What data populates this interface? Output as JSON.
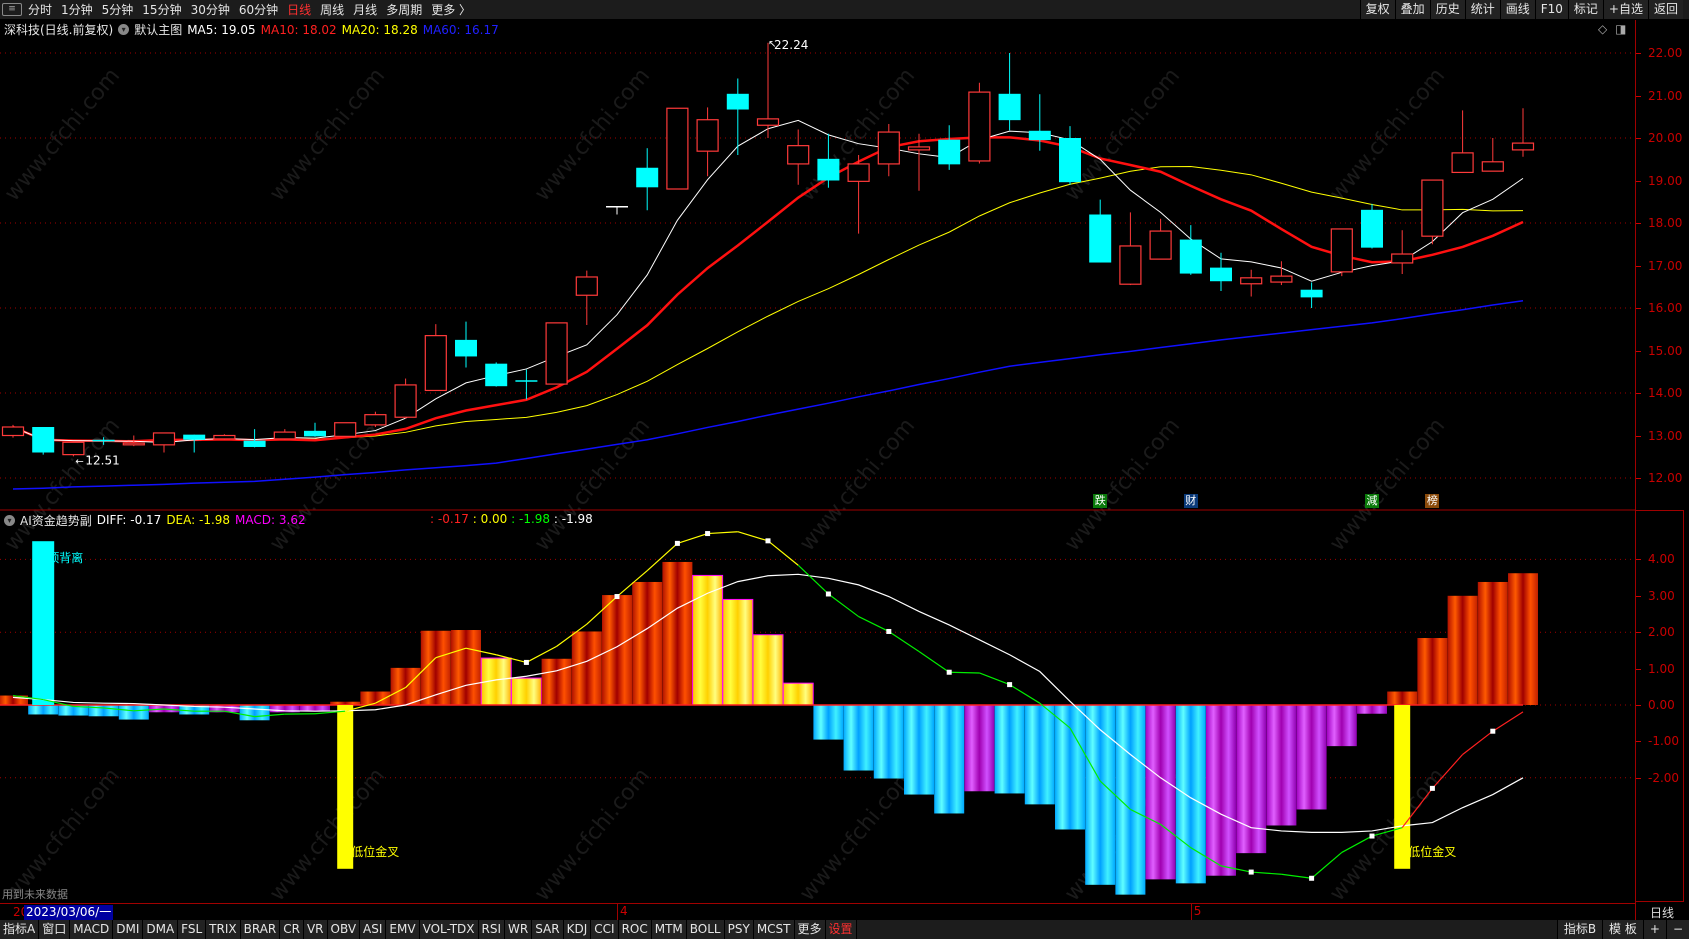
{
  "toolbar": {
    "periods": [
      "分时",
      "1分钟",
      "5分钟",
      "15分钟",
      "30分钟",
      "60分钟",
      "日线",
      "周线",
      "月线",
      "多周期",
      "更多 〉"
    ],
    "active_period": "日线",
    "right_buttons": [
      "复权",
      "叠加",
      "历史",
      "统计",
      "画线",
      "F10",
      "标记",
      "+自选",
      "返回"
    ]
  },
  "main_info": {
    "title": "深科技(日线.前复权)",
    "template": "默认主图",
    "ma5": "MA5: 19.05",
    "ma10": "MA10: 18.02",
    "ma20": "MA20: 18.28",
    "ma60": "MA60: 16.17"
  },
  "colors": {
    "up": "#ff3a3a",
    "down": "#00ffff",
    "ma5": "#ffffff",
    "ma10": "#ff1010",
    "ma20": "#ffff00",
    "ma60": "#1010ff",
    "axis": "#c80000"
  },
  "price_axis": {
    "labels": [
      "22.00",
      "21.00",
      "20.00",
      "19.00",
      "18.00",
      "17.00",
      "16.00",
      "15.00",
      "14.00",
      "13.00",
      "12.00"
    ]
  },
  "annotations": {
    "high_label": "22.24",
    "high_index": 25,
    "low_label": "12.51",
    "low_index": 2
  },
  "signal_tags": [
    {
      "text": "跌",
      "index": 36,
      "color": "#0a7a0a"
    },
    {
      "text": "财",
      "index": 39,
      "color": "#0a3a7a"
    },
    {
      "text": "減",
      "index": 45,
      "color": "#0a7a0a"
    },
    {
      "text": "榜",
      "index": 47,
      "color": "#8a4a0a"
    }
  ],
  "chart_data": {
    "type": "candlestick",
    "ylim": [
      11.5,
      22.5
    ],
    "ohlc": [
      [
        13.0,
        13.25,
        12.95,
        13.2
      ],
      [
        13.2,
        13.2,
        12.55,
        12.6
      ],
      [
        12.55,
        12.85,
        12.51,
        12.84
      ],
      [
        12.9,
        12.96,
        12.78,
        12.86
      ],
      [
        12.78,
        13.0,
        12.75,
        12.82
      ],
      [
        12.78,
        13.07,
        12.6,
        13.06
      ],
      [
        13.02,
        13.02,
        12.6,
        12.9
      ],
      [
        12.92,
        13.03,
        12.9,
        13.0
      ],
      [
        12.88,
        13.15,
        12.72,
        12.73
      ],
      [
        12.92,
        13.15,
        12.9,
        13.08
      ],
      [
        13.11,
        13.3,
        12.97,
        12.98
      ],
      [
        12.98,
        13.3,
        12.97,
        13.3
      ],
      [
        13.25,
        13.56,
        13.2,
        13.49
      ],
      [
        13.43,
        14.34,
        13.4,
        14.19
      ],
      [
        14.06,
        15.62,
        14.05,
        15.35
      ],
      [
        15.25,
        15.68,
        14.6,
        14.86
      ],
      [
        14.69,
        14.72,
        14.15,
        14.16
      ],
      [
        14.3,
        14.55,
        13.85,
        14.27
      ],
      [
        14.21,
        15.65,
        14.2,
        15.65
      ],
      [
        16.3,
        16.88,
        15.6,
        16.73
      ],
      [
        18.4,
        18.4,
        18.2,
        18.4
      ],
      [
        19.3,
        19.76,
        18.3,
        18.84
      ],
      [
        18.8,
        20.7,
        18.8,
        20.7
      ],
      [
        19.69,
        20.72,
        19.1,
        20.43
      ],
      [
        21.04,
        21.4,
        19.6,
        20.67
      ],
      [
        20.3,
        22.24,
        20.0,
        20.45
      ],
      [
        19.39,
        20.2,
        18.9,
        19.82
      ],
      [
        19.51,
        20.1,
        18.83,
        19.0
      ],
      [
        18.98,
        19.6,
        17.75,
        19.39
      ],
      [
        19.39,
        20.33,
        19.1,
        20.14
      ],
      [
        19.72,
        20.1,
        18.76,
        19.79
      ],
      [
        19.96,
        20.3,
        19.25,
        19.38
      ],
      [
        19.46,
        21.3,
        19.4,
        21.08
      ],
      [
        21.04,
        22.0,
        20.18,
        20.42
      ],
      [
        20.17,
        21.03,
        19.7,
        19.95
      ],
      [
        20.0,
        20.28,
        18.9,
        18.96
      ],
      [
        18.2,
        18.55,
        17.07,
        17.07
      ],
      [
        16.56,
        18.25,
        16.54,
        17.46
      ],
      [
        17.15,
        18.1,
        17.15,
        17.81
      ],
      [
        17.61,
        17.95,
        16.78,
        16.81
      ],
      [
        16.95,
        17.3,
        16.4,
        16.63
      ],
      [
        16.57,
        16.9,
        16.27,
        16.71
      ],
      [
        16.61,
        17.1,
        16.54,
        16.75
      ],
      [
        16.43,
        16.6,
        16.0,
        16.25
      ],
      [
        16.85,
        17.86,
        16.75,
        17.86
      ],
      [
        18.31,
        18.45,
        17.4,
        17.42
      ],
      [
        17.06,
        17.83,
        16.8,
        17.27
      ],
      [
        17.69,
        19.01,
        17.5,
        19.01
      ],
      [
        19.19,
        20.65,
        19.18,
        19.65
      ],
      [
        19.22,
        20.0,
        19.22,
        19.44
      ],
      [
        19.72,
        20.7,
        19.56,
        19.88
      ]
    ],
    "ma60": [
      11.74,
      11.76,
      11.79,
      11.81,
      11.83,
      11.85,
      11.88,
      11.9,
      11.92,
      11.97,
      12.02,
      12.08,
      12.13,
      12.19,
      12.24,
      12.29,
      12.35,
      12.46,
      12.57,
      12.68,
      12.79,
      12.9,
      13.04,
      13.19,
      13.33,
      13.48,
      13.62,
      13.76,
      13.91,
      14.05,
      14.2,
      14.34,
      14.49,
      14.63,
      14.72,
      14.81,
      14.9,
      14.98,
      15.07,
      15.16,
      15.25,
      15.33,
      15.41,
      15.49,
      15.57,
      15.65,
      15.75,
      15.86,
      15.96,
      16.07,
      16.17
    ]
  },
  "indicator": {
    "name": "AI资金趋势副",
    "diff_label": "DIFF: -0.17",
    "dea_label": "DEA: -1.98",
    "macd_label": "MACD: 3.62",
    "values_line": [
      ": -0.17",
      ": 0.00",
      ": -1.98",
      ": -1.98"
    ],
    "axis_labels": [
      "4.00",
      "3.00",
      "2.00",
      "1.00",
      "0.00",
      "-1.00",
      "-2.00"
    ],
    "ylim": [
      -6,
      5.4
    ],
    "macd": [
      0.26,
      -0.26,
      -0.29,
      -0.31,
      -0.4,
      -0.2,
      -0.26,
      -0.2,
      -0.42,
      -0.2,
      -0.17,
      0.09,
      0.37,
      1.02,
      2.04,
      2.06,
      1.29,
      0.74,
      1.27,
      2.02,
      3.02,
      3.38,
      3.93,
      3.56,
      2.9,
      1.93,
      0.6,
      -0.95,
      -1.8,
      -2.02,
      -2.46,
      -2.98,
      -2.37,
      -2.43,
      -2.73,
      -3.42,
      -4.94,
      -5.21,
      -4.79,
      -4.9,
      -4.69,
      -4.07,
      -3.31,
      -2.87,
      -1.13,
      -0.24,
      0.37,
      1.84,
      3.0,
      3.38,
      3.62
    ],
    "diff": [
      0.26,
      0.15,
      -0.04,
      -0.08,
      -0.16,
      -0.11,
      -0.17,
      -0.17,
      -0.32,
      -0.25,
      -0.24,
      -0.17,
      0.05,
      0.48,
      1.3,
      1.56,
      1.38,
      1.17,
      1.61,
      2.22,
      2.98,
      3.69,
      4.44,
      4.71,
      4.76,
      4.51,
      3.84,
      3.05,
      2.43,
      2.02,
      1.47,
      0.9,
      0.88,
      0.56,
      0.05,
      -0.63,
      -2.09,
      -2.87,
      -3.28,
      -3.92,
      -4.42,
      -4.59,
      -4.65,
      -4.76,
      -4.05,
      -3.6,
      -3.37,
      -2.29,
      -1.36,
      -0.72,
      -0.19
    ],
    "dea": [
      0.21,
      0.15,
      0.07,
      0.05,
      0.04,
      0,
      -0.04,
      -0.06,
      -0.11,
      -0.16,
      -0.17,
      -0.16,
      -0.13,
      0,
      0.28,
      0.54,
      0.69,
      0.79,
      0.94,
      1.2,
      1.6,
      2.1,
      2.66,
      3.07,
      3.39,
      3.55,
      3.59,
      3.48,
      3.3,
      2.98,
      2.57,
      2.2,
      1.79,
      1.38,
      0.92,
      0.1,
      -0.68,
      -1.36,
      -2.0,
      -2.55,
      -3.0,
      -3.37,
      -3.46,
      -3.5,
      -3.5,
      -3.46,
      -3.32,
      -3.23,
      -2.82,
      -2.46,
      -2.0
    ],
    "signals": [
      {
        "index": 1,
        "type": "top",
        "value": 4.5,
        "text": "顶背离",
        "color": "#00ffff"
      },
      {
        "index": 11,
        "type": "bottom",
        "value": -4.5,
        "text": "低位金叉",
        "color": "#ffff00"
      },
      {
        "index": 46,
        "type": "bottom",
        "value": -4.5,
        "text": "低位金叉",
        "color": "#ffff00"
      }
    ]
  },
  "footer": {
    "future_note": "用到未来数据",
    "year_prefix": "20",
    "selected_date": "2023/03/06/一",
    "months": [
      {
        "label": "4",
        "index": 20
      },
      {
        "label": "5",
        "index": 39
      }
    ],
    "period_label": "日线",
    "tabs": [
      "指标A",
      "窗口",
      "MACD",
      "DMI",
      "DMA",
      "FSL",
      "TRIX",
      "BRAR",
      "CR",
      "VR",
      "OBV",
      "ASI",
      "EMV",
      "VOL-TDX",
      "RSI",
      "WR",
      "SAR",
      "KDJ",
      "CCI",
      "ROC",
      "MTM",
      "BOLL",
      "PSY",
      "MCST",
      "更多",
      "设置"
    ],
    "right_tabs": [
      "指标B",
      "模 板",
      "+",
      "−"
    ]
  },
  "watermark": "www.cfchi.com"
}
